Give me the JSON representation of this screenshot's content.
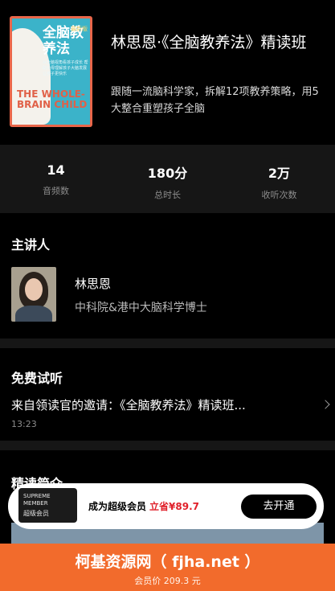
{
  "course": {
    "cover": {
      "title": "全脑教养法",
      "tag": "最新版",
      "subtitle": "从全脑视角看孩子成长 帮助父母理解孩子大脑发展 让孩子更快乐",
      "english": "THE WHOLE-BRAIN CHILD"
    },
    "title": "林思恩·《全脑教养法》精读班",
    "description": "跟随一流脑科学家，拆解12项教养策略，用5大整合重塑孩子全脑"
  },
  "stats": [
    {
      "value": "14",
      "label": "音频数"
    },
    {
      "value": "180分",
      "label": "总时长"
    },
    {
      "value": "2万",
      "label": "收听次数"
    }
  ],
  "lecturer": {
    "section_title": "主讲人",
    "name": "林思恩",
    "title": "中科院&港中大脑科学博士"
  },
  "trial": {
    "section_title": "免费试听",
    "item_title": "来自领读官的邀请：《全脑教养法》精读班...",
    "item_time": "13:23"
  },
  "intro": {
    "section_title": "精读简介"
  },
  "member_banner": {
    "card_line1": "SUPREME",
    "card_line2": "MEMBER",
    "card_cn": "超级会员",
    "text": "成为超级会员",
    "save": "立省¥89.7",
    "button": "去开通"
  },
  "buy_bar": {
    "main": "柯基资源网（ fjha.net ）",
    "sub": "会员价 209.3 元"
  }
}
